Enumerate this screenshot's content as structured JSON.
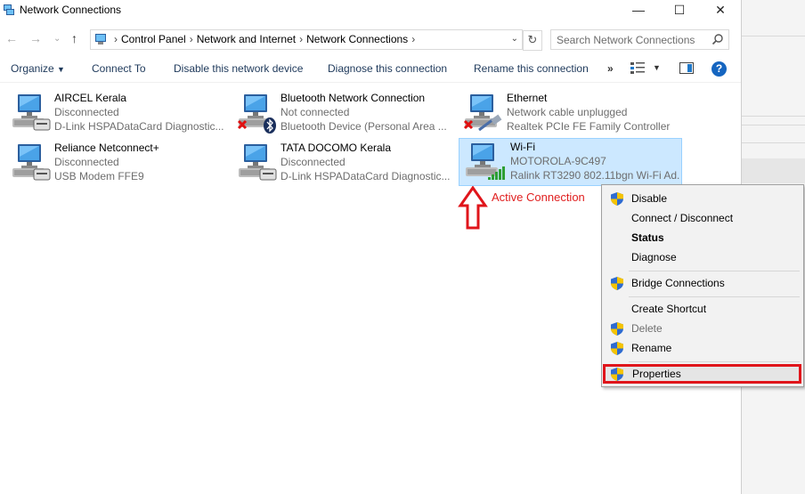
{
  "window": {
    "title": "Network Connections",
    "controls": {
      "minimize": "—",
      "maximize": "☐",
      "close": "✕"
    }
  },
  "address": {
    "breadcrumbs": [
      "Control Panel",
      "Network and Internet",
      "Network Connections"
    ],
    "search_placeholder": "Search Network Connections"
  },
  "toolbar": {
    "organize": "Organize",
    "connect_to": "Connect To",
    "disable": "Disable this network device",
    "diagnose": "Diagnose this connection",
    "rename": "Rename this connection",
    "more": "»",
    "help": "?"
  },
  "connections": [
    {
      "name": "AIRCEL Kerala",
      "status": "Disconnected",
      "device": "D-Link HSPADataCard Diagnostic...",
      "icon": "modem-icon"
    },
    {
      "name": "Bluetooth Network Connection",
      "status": "Not connected",
      "device": "Bluetooth Device (Personal Area ...",
      "icon": "bluetooth-network-icon"
    },
    {
      "name": "Ethernet",
      "status": "Network cable unplugged",
      "device": "Realtek PCIe FE Family Controller",
      "icon": "ethernet-icon"
    },
    {
      "name": "Reliance Netconnect+",
      "status": "Disconnected",
      "device": "USB Modem FFE9",
      "icon": "modem-icon"
    },
    {
      "name": "TATA DOCOMO Kerala",
      "status": "Disconnected",
      "device": "D-Link HSPADataCard Diagnostic...",
      "icon": "modem-icon"
    },
    {
      "name": "Wi-Fi",
      "status": "MOTOROLA-9C497",
      "device": "Ralink RT3290 802.11bgn Wi-Fi Ad...",
      "icon": "wifi-icon"
    }
  ],
  "annotation": {
    "label": "Active Connection",
    "color": "#e02020"
  },
  "context_menu": {
    "items": [
      {
        "label": "Disable",
        "shield": true
      },
      {
        "label": "Connect / Disconnect",
        "shield": false
      },
      {
        "label": "Status",
        "shield": false,
        "bold": true
      },
      {
        "label": "Diagnose",
        "shield": false
      },
      {
        "label": "Bridge Connections",
        "shield": true
      },
      {
        "label": "Create Shortcut",
        "shield": false
      },
      {
        "label": "Delete",
        "shield": true,
        "disabled": true
      },
      {
        "label": "Rename",
        "shield": true
      },
      {
        "label": "Properties",
        "shield": true,
        "highlighted": true
      }
    ]
  },
  "colors": {
    "selection": "#cce8ff",
    "highlight_border": "#e0151b",
    "command_text": "#1e395b"
  }
}
